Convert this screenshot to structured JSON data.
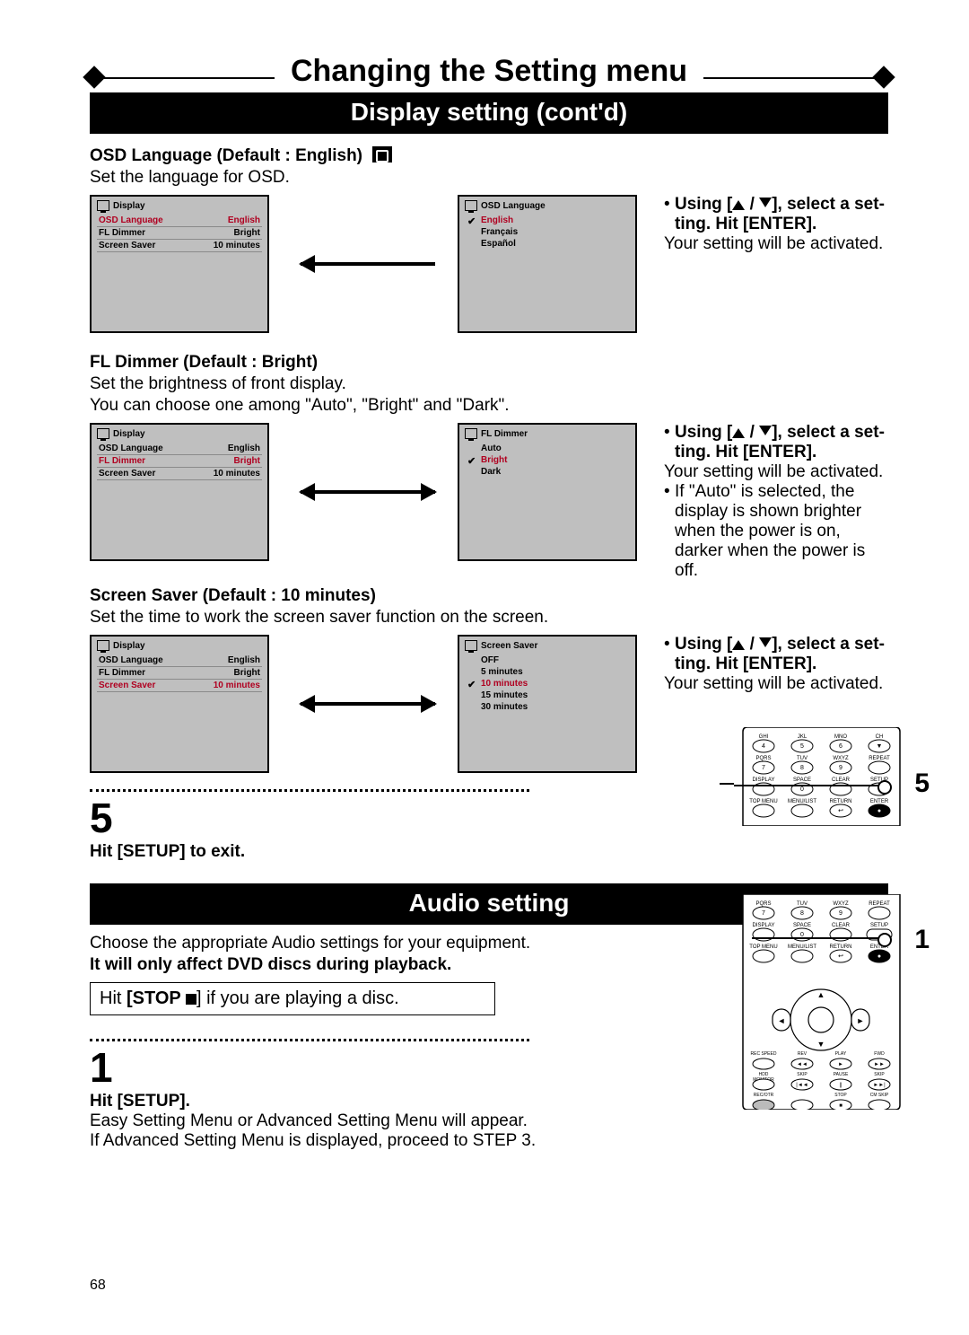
{
  "page_number": "68",
  "title": "Changing the Setting menu",
  "section1": "Display setting (cont'd)",
  "section2": "Audio setting",
  "osd": {
    "heading": "OSD Language (Default : English)",
    "desc": "Set the language for OSD.",
    "menu_title": "Display",
    "rows": [
      {
        "k": "OSD Language",
        "v": "English",
        "sel": true
      },
      {
        "k": "FL Dimmer",
        "v": "Bright"
      },
      {
        "k": "Screen Saver",
        "v": "10 minutes"
      }
    ],
    "sub_title": "OSD Language",
    "sub_items": [
      {
        "label": "English",
        "check": true,
        "sel": true
      },
      {
        "label": "Français"
      },
      {
        "label": "Español"
      }
    ],
    "instr_bold1": "Using [",
    "instr_bold2": "], select a set-",
    "instr_bold3": "ting. Hit [ENTER].",
    "instr_plain": "Your setting will be activated."
  },
  "fl": {
    "heading": "FL Dimmer (Default : Bright)",
    "desc1": "Set the brightness of front display.",
    "desc2": "You can choose one among \"Auto\", \"Bright\" and \"Dark\".",
    "menu_title": "Display",
    "rows": [
      {
        "k": "OSD Language",
        "v": "English"
      },
      {
        "k": "FL Dimmer",
        "v": "Bright",
        "sel": true
      },
      {
        "k": "Screen Saver",
        "v": "10 minutes"
      }
    ],
    "sub_title": "FL Dimmer",
    "sub_items": [
      {
        "label": "Auto"
      },
      {
        "label": "Bright",
        "check": true,
        "sel": true
      },
      {
        "label": "Dark"
      }
    ],
    "instr_plain": "Your setting will be activated.",
    "extra": "If \"Auto\" is selected, the display is shown brighter when the power is on, darker when the power is off."
  },
  "ss": {
    "heading": "Screen Saver (Default : 10 minutes)",
    "desc": "Set the time to work the screen saver function on the screen.",
    "menu_title": "Display",
    "rows": [
      {
        "k": "OSD Language",
        "v": "English"
      },
      {
        "k": "FL Dimmer",
        "v": "Bright"
      },
      {
        "k": "Screen Saver",
        "v": "10 minutes",
        "sel": true
      }
    ],
    "sub_title": "Screen Saver",
    "sub_items": [
      {
        "label": "OFF"
      },
      {
        "label": "5 minutes"
      },
      {
        "label": "10 minutes",
        "check": true,
        "sel": true
      },
      {
        "label": "15 minutes"
      },
      {
        "label": "30 minutes"
      }
    ],
    "instr_plain": "Your setting will be activated."
  },
  "step5": {
    "num": "5",
    "text": "Hit [SETUP] to exit.",
    "callout": "5"
  },
  "audio": {
    "intro": "Choose the appropriate Audio settings for your equipment.",
    "bold": "It will only affect DVD discs during playback.",
    "box_pre": "Hit ",
    "box_bold": "[STOP ",
    "box_post": "] if you are playing a disc.",
    "callout": "1"
  },
  "step1": {
    "num": "1",
    "head": "Hit [SETUP].",
    "l1": "Easy Setting Menu or Advanced Setting Menu will appear.",
    "l2": "If Advanced Setting Menu is displayed, proceed to STEP 3."
  },
  "remote_labels": {
    "row1": [
      "GHI",
      "JKL",
      "MNO",
      "CH"
    ],
    "row1n": [
      "4",
      "5",
      "6",
      "▼"
    ],
    "row2": [
      "PQRS",
      "TUV",
      "WXYZ",
      "REPEAT"
    ],
    "row2n": [
      "7",
      "8",
      "9",
      ""
    ],
    "row3": [
      "DISPLAY",
      "SPACE",
      "CLEAR",
      "SETUP"
    ],
    "row3n": [
      "",
      "0",
      "",
      ""
    ],
    "row4": [
      "TOP MENU",
      "MENU/LIST",
      "RETURN",
      "ENTER"
    ],
    "extra": [
      "REC SPEED",
      "REV",
      "PLAY",
      "FWD",
      "HDD MONITOR",
      "SKIP",
      "PAUSE",
      "SKIP",
      "REC/OTR",
      "STOP",
      "CM SKIP"
    ],
    "dpad": [
      "▲",
      "◄",
      "►",
      "▼"
    ]
  }
}
